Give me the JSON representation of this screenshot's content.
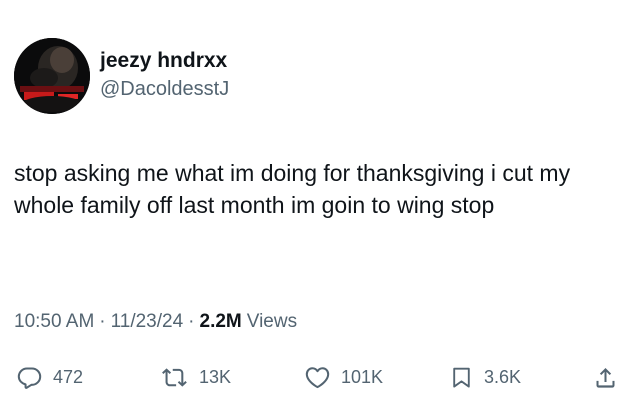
{
  "tweet": {
    "display_name": "jeezy hndrxx",
    "handle": "@DacoldesstJ",
    "text": "stop asking me what im doing for thanksgiving i cut my whole family off last month im goin to wing stop",
    "time": "10:50 AM",
    "date": "11/23/24",
    "separator": "·",
    "views_count": "2.2M",
    "views_label": "Views"
  },
  "actions": {
    "replies": {
      "icon": "reply-icon",
      "count": "472"
    },
    "reposts": {
      "icon": "repost-icon",
      "count": "13K"
    },
    "likes": {
      "icon": "heart-icon",
      "count": "101K"
    },
    "bookmarks": {
      "icon": "bookmark-icon",
      "count": "3.6K"
    },
    "share": {
      "icon": "share-icon"
    }
  },
  "colors": {
    "text_primary": "#0f1419",
    "text_secondary": "#536471",
    "background": "#ffffff"
  }
}
